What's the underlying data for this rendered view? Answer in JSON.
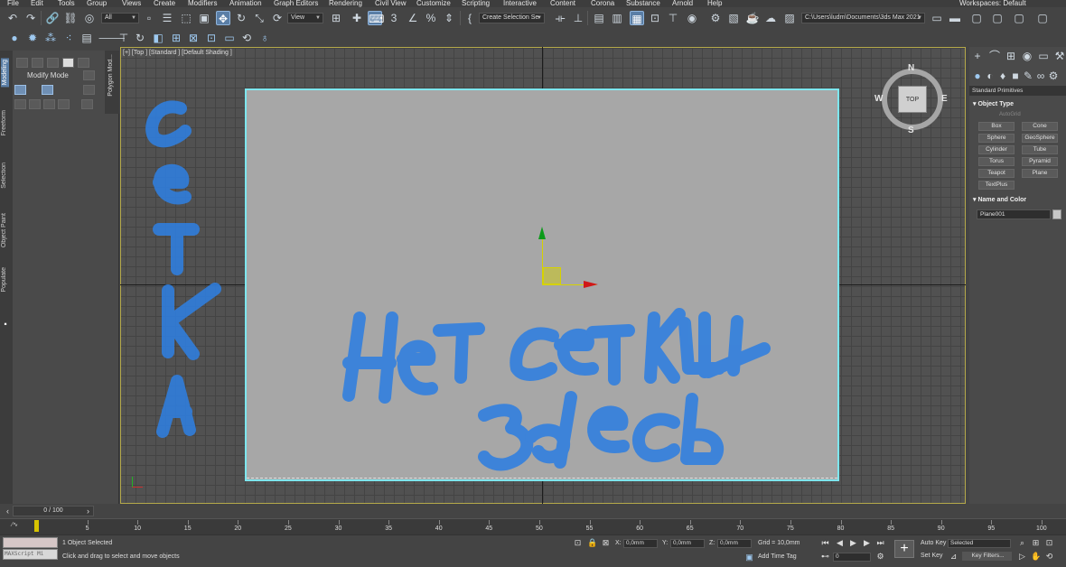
{
  "menu": {
    "items": [
      "File",
      "Edit",
      "Tools",
      "Group",
      "Views",
      "Create",
      "Modifiers",
      "Animation",
      "Graph Editors",
      "Rendering",
      "Civil View",
      "Customize",
      "Scripting",
      "Interactive",
      "Content",
      "Corona",
      "Substance",
      "Arnold",
      "Help"
    ],
    "workspaces_label": "Workspaces:",
    "workspaces_value": "Default"
  },
  "toolbar": {
    "selection_filter": "All",
    "reference_coord": "View",
    "selection_set": "Create Selection Se",
    "project_path": "C:\\Users\\ludm\\Documents\\3ds Max 2021"
  },
  "left_ribbon": {
    "tabs": [
      "Modeling",
      "Freeform",
      "Selection",
      "Object Paint",
      "Populate"
    ],
    "active_tab": "Modeling",
    "mode_label": "Modify Mode",
    "polygon_tab": "Polygon Mod..."
  },
  "viewport": {
    "label": "[+] [Top ] [Standard ] [Default Shading ]",
    "viewcube_face": "TOP",
    "compass": {
      "n": "N",
      "s": "S",
      "e": "E",
      "w": "W"
    },
    "handwriting": {
      "vertical": [
        "С",
        "е",
        "т",
        "к",
        "а"
      ],
      "line1": "нет сетки",
      "line2": "здесь",
      "color": "#2f7fe0"
    }
  },
  "command_panel": {
    "category": "Standard Primitives",
    "object_type_header": "Object Type",
    "autogrid": "AutoGrid",
    "primitives": [
      "Box",
      "Cone",
      "Sphere",
      "GeoSphere",
      "Cylinder",
      "Tube",
      "Torus",
      "Pyramid",
      "Teapot",
      "Plane",
      "TextPlus"
    ],
    "name_color_header": "Name and Color",
    "object_name": "Plane001"
  },
  "timeline": {
    "slider_label": "0 / 100",
    "ticks": [
      "0",
      "5",
      "10",
      "15",
      "20",
      "25",
      "30",
      "35",
      "40",
      "45",
      "50",
      "55",
      "60",
      "65",
      "70",
      "75",
      "80",
      "85",
      "90",
      "95",
      "100"
    ]
  },
  "status": {
    "maxscript_label": "MAXScript Mi",
    "selection_count": "1 Object Selected",
    "prompt": "Click and drag to select and move objects",
    "x_label": "X:",
    "x_value": "0,0mm",
    "y_label": "Y:",
    "y_value": "0,0mm",
    "z_label": "Z:",
    "z_value": "0,0mm",
    "grid": "Grid = 10,0mm",
    "add_time_tag": "Add Time Tag",
    "auto_key": "Auto Key",
    "set_key": "Set Key",
    "key_mode": "Selected",
    "key_filters": "Key Filters...",
    "frame_value": "0"
  }
}
